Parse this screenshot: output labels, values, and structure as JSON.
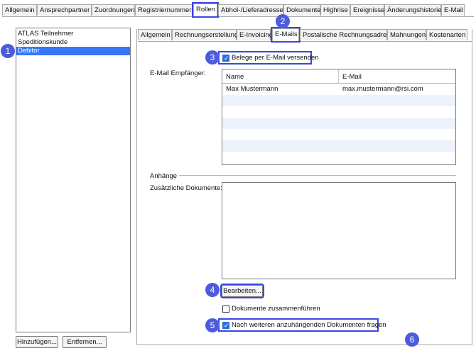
{
  "main_tabs": [
    {
      "label": "Allgemein"
    },
    {
      "label": "Ansprechpartner"
    },
    {
      "label": "Zuordnungen"
    },
    {
      "label": "Registriernummern"
    },
    {
      "label": "Rollen"
    },
    {
      "label": "Abhol-/Lieferadressen"
    },
    {
      "label": "Dokumente"
    },
    {
      "label": "Highrise"
    },
    {
      "label": "Ereignisse"
    },
    {
      "label": "Änderungshistorie"
    },
    {
      "label": "E-Mail"
    }
  ],
  "roles_list": {
    "items": [
      {
        "label": "ATLAS Teilnehmer"
      },
      {
        "label": "Speditionskunde"
      },
      {
        "label": "Debitor"
      }
    ]
  },
  "buttons": {
    "add": "Hinzufügen...",
    "remove": "Entfernen...",
    "edit": "Bearbeiten..."
  },
  "sub_tabs": [
    {
      "label": "Allgemein"
    },
    {
      "label": "Rechnungserstellung"
    },
    {
      "label": "E-Invoicing"
    },
    {
      "label": "E-Mails"
    },
    {
      "label": "Postalische Rechnungsadresse"
    },
    {
      "label": "Mahnungen"
    },
    {
      "label": "Kostenarten"
    }
  ],
  "emails": {
    "send_by_email_label": "Belege per E-Mail versenden",
    "recipients_label": "E-Mail Empfänger:",
    "table": {
      "columns": [
        "Name",
        "E-Mail"
      ],
      "rows": [
        {
          "name": "Max Mustermann",
          "email": "max.mustermann@rsi.com"
        }
      ]
    },
    "attachments_section": "Anhänge",
    "additional_docs_label": "Zusätzliche Dokumente:",
    "merge_docs_label": "Dokumente zusammenführen",
    "ask_more_docs_label": "Nach weiteren anzuhängenden Dokumenten fragen"
  },
  "badges": [
    "1",
    "2",
    "3",
    "4",
    "5",
    "6"
  ],
  "colors": {
    "highlight": "#3b44e6",
    "badge": "#4e5bdc",
    "selection": "#3478f6"
  }
}
